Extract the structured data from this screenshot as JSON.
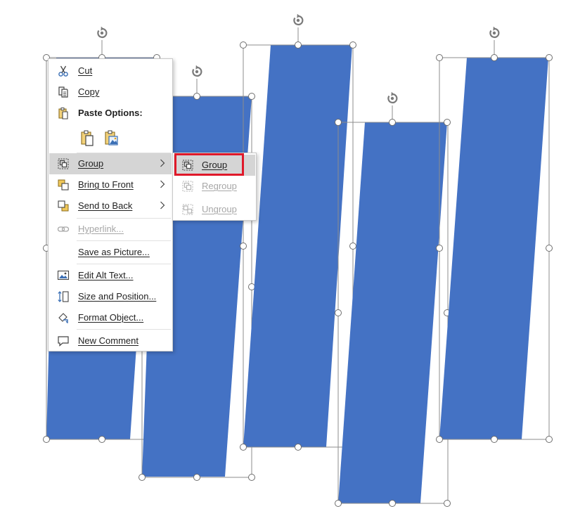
{
  "colors": {
    "shape_fill": "#4472c4",
    "selection_line": "#8c8c8c",
    "handle_fill": "#ffffff",
    "menu_hover": "#d5d5d5",
    "highlight": "#e0192a",
    "disabled_text": "#a7a7a7"
  },
  "context_menu": {
    "items": [
      {
        "label": "Cut",
        "icon": "scissors-icon"
      },
      {
        "label": "Copy",
        "icon": "copy-icon"
      },
      {
        "label": "Paste Options:",
        "icon": "paste-icon"
      },
      {
        "label": "Group",
        "icon": "group-icon",
        "has_submenu": true,
        "hovered": true
      },
      {
        "label": "Bring to Front",
        "icon": "bring-to-front-icon",
        "has_submenu": true
      },
      {
        "label": "Send to Back",
        "icon": "send-to-back-icon",
        "has_submenu": true
      },
      {
        "label": "Hyperlink...",
        "icon": "link-icon",
        "disabled": true
      },
      {
        "label": "Save as Picture...",
        "icon": ""
      },
      {
        "label": "Edit Alt Text...",
        "icon": "alt-text-icon"
      },
      {
        "label": "Size and Position...",
        "icon": "size-position-icon"
      },
      {
        "label": "Format Object...",
        "icon": "format-brush-icon"
      },
      {
        "label": "New Comment",
        "icon": "comment-icon"
      }
    ],
    "paste_buttons": [
      {
        "name": "paste-keep-formatting",
        "icon": "clipboard-icon"
      },
      {
        "name": "paste-as-picture",
        "icon": "clipboard-picture-icon"
      }
    ]
  },
  "submenu": {
    "items": [
      {
        "label": "Group",
        "icon": "group-icon",
        "highlighted": true
      },
      {
        "label": "Regroup",
        "icon": "regroup-icon",
        "disabled": true
      },
      {
        "label": "Ungroup",
        "icon": "ungroup-icon",
        "disabled": true
      }
    ]
  }
}
